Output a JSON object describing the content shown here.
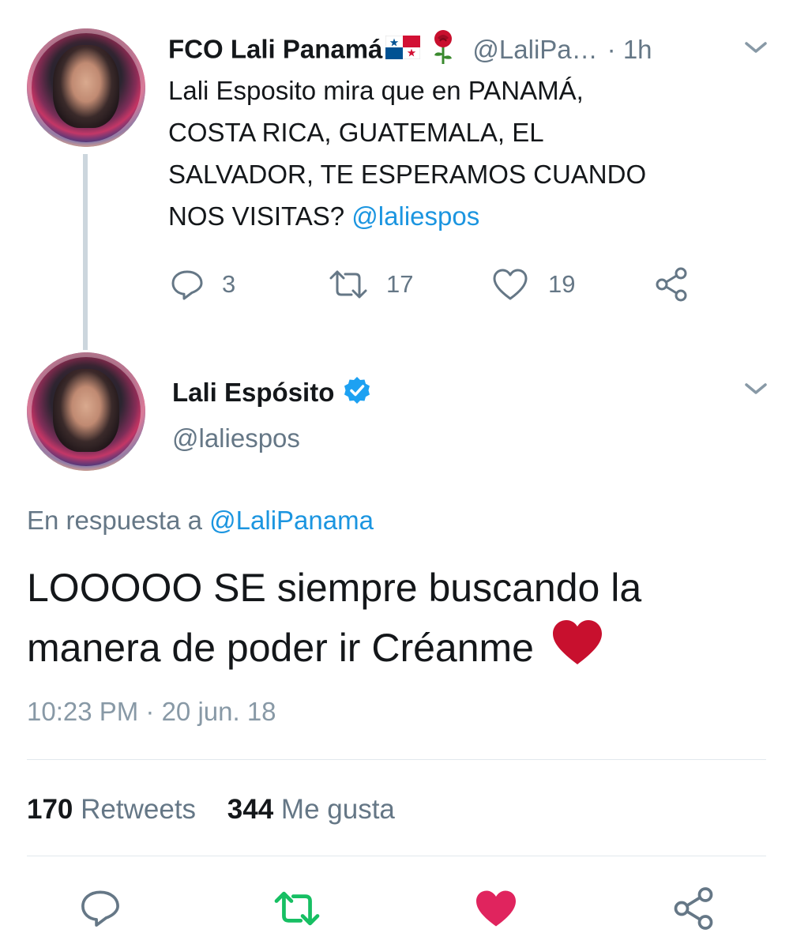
{
  "parent_tweet": {
    "author_name": "FCO Lali Panamá",
    "author_handle": "@LaliPa…",
    "time_ago": "· 1h",
    "text_lines": [
      "Lali Esposito mira que en PANAMÁ,",
      "COSTA RICA, GUATEMALA, EL",
      "SALVADOR, TE ESPERAMOS CUANDO",
      "NOS VISITAS?"
    ],
    "mention": "@laliespos",
    "replies": "3",
    "retweets": "17",
    "likes": "19",
    "icons": [
      "panama-flag-icon",
      "rose-icon",
      "chevron-down-icon",
      "reply-icon",
      "retweet-icon",
      "like-icon",
      "share-icon"
    ]
  },
  "main_tweet": {
    "author_name": "Lali Espósito",
    "author_handle": "@laliespos",
    "verified": true,
    "reply_prefix": "En respuesta a",
    "reply_to": "@LaliPanama",
    "text_lines": [
      "LOOOOO SE siempre buscando la",
      "manera de poder ir Créanme"
    ],
    "timestamp": "10:23 PM · 20 jun. 18",
    "retweet_count": "170",
    "retweet_label": "Retweets",
    "like_count": "344",
    "like_label": "Me gusta",
    "icons": [
      "verified-badge-icon",
      "heart-emoji-icon",
      "reply-icon",
      "retweet-icon",
      "like-icon",
      "share-icon"
    ]
  },
  "colors": {
    "link": "#1b95e0",
    "muted": "#657786",
    "retweet_active": "#17bf63",
    "like_active": "#e0245e",
    "heart_emoji": "#c8102e"
  }
}
